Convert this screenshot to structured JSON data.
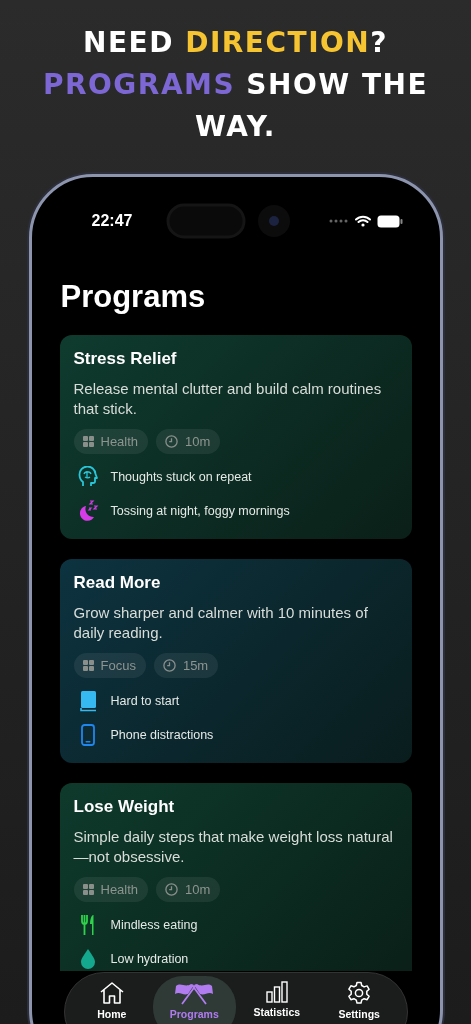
{
  "headline": [
    {
      "text": "NEED ",
      "color": "#ffffff"
    },
    {
      "text": "DIRECTION",
      "color": "#f7c431"
    },
    {
      "text": "? ",
      "color": "#ffffff"
    },
    {
      "text": "PROGRAMS",
      "color": "#7c67d4"
    },
    {
      "text": " SHOW THE WAY.",
      "color": "#ffffff"
    }
  ],
  "status_bar": {
    "time": "22:47"
  },
  "title": "Programs",
  "programs": [
    {
      "title": "Stress Relief",
      "description": "Release mental clutter and build calm routines that stick.",
      "color": "#0f3b2f",
      "category": "Health",
      "duration": "10m",
      "problems": [
        {
          "kind": "brain",
          "text": "Thoughts stuck on repeat",
          "color": "#27c6d9"
        },
        {
          "kind": "moon",
          "text": "Tossing at night, foggy mornings",
          "color": "#d63be8"
        }
      ]
    },
    {
      "title": "Read More",
      "description": "Grow sharper and calmer with 10 minutes of daily reading.",
      "color": "#0d3340",
      "category": "Focus",
      "duration": "15m",
      "problems": [
        {
          "kind": "book",
          "text": "Hard to start",
          "color": "#36b9f0"
        },
        {
          "kind": "phone",
          "text": "Phone distractions",
          "color": "#1f86f0"
        }
      ]
    },
    {
      "title": "Lose Weight",
      "description": "Simple daily steps that make weight loss natural—not obsessive.",
      "color": "#0e3a2c",
      "category": "Health",
      "duration": "10m",
      "problems": [
        {
          "kind": "fork",
          "text": "Mindless eating",
          "color": "#2fd24a"
        },
        {
          "kind": "drop",
          "text": "Low hydration",
          "color": "#14a88e"
        }
      ]
    }
  ],
  "tabs": [
    {
      "kind": "home",
      "label": "Home",
      "selected": false
    },
    {
      "kind": "flags",
      "label": "Programs",
      "selected": true
    },
    {
      "kind": "stats",
      "label": "Statistics",
      "selected": false
    },
    {
      "kind": "gear",
      "label": "Settings",
      "selected": false
    }
  ]
}
